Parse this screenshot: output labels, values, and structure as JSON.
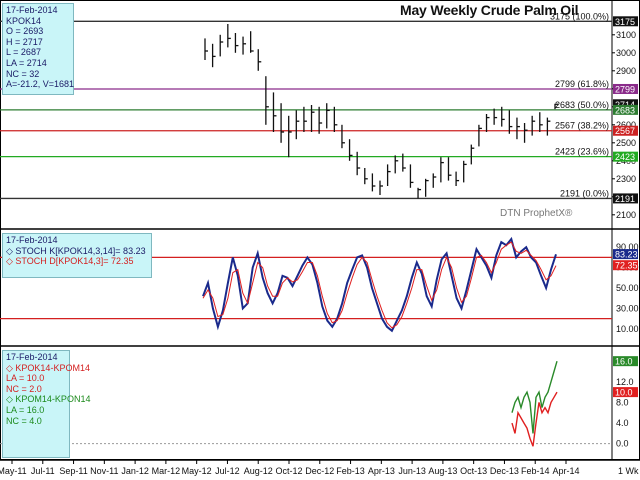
{
  "title": "May Weekly Crude Palm Oil",
  "watermark": "DTN ProphetX®",
  "price_panel": {
    "info": {
      "date": "17-Feb-2014",
      "symbol": "KPOK14",
      "open": "O = 2693",
      "high": "H = 2717",
      "low": "L = 2687",
      "last": "LA = 2714",
      "nc": "NC = 32",
      "avg": "A=-21.2, V=1681"
    },
    "fib_levels": [
      {
        "value": 3175,
        "label": "3175 (100.0%)",
        "color": "#333333"
      },
      {
        "value": 2799,
        "label": "2799 (61.8%)",
        "color": "#8a2b8a"
      },
      {
        "value": 2683,
        "label": "2683 (50.0%)",
        "color": "#2e7d32"
      },
      {
        "value": 2567,
        "label": "2567 (38.2%)",
        "color": "#cc2222"
      },
      {
        "value": 2423,
        "label": "2423 (23.6%)",
        "color": "#22aa22"
      },
      {
        "value": 2191,
        "label": "2191 (0.0%)",
        "color": "#333333"
      }
    ],
    "y_ticks": [
      "3100",
      "3000",
      "2900",
      "2800",
      "2700",
      "2600",
      "2500",
      "2400",
      "2300",
      "2200",
      "2100"
    ],
    "right_markers": [
      {
        "value": 3175,
        "label": "3175",
        "bg": "#111111"
      },
      {
        "value": 2799,
        "label": "2799",
        "bg": "#8a2b8a"
      },
      {
        "value": 2714,
        "label": "2714",
        "bg": "#111111"
      },
      {
        "value": 2683,
        "label": "2683",
        "bg": "#2e7d32"
      },
      {
        "value": 2567,
        "label": "2567",
        "bg": "#cc2222"
      },
      {
        "value": 2423,
        "label": "2423",
        "bg": "#22aa22"
      },
      {
        "value": 2191,
        "label": "2191",
        "bg": "#111111"
      }
    ]
  },
  "stoch_panel": {
    "info": {
      "date": "17-Feb-2014",
      "k_label": "STOCH K[KPOK14,3,14]= 83.23",
      "d_label": "STOCH D[KPOK14,3]= 72.35"
    },
    "y_ticks": [
      "90.00",
      "70.00",
      "50.00",
      "30.00",
      "10.00"
    ],
    "k_value": "83.23",
    "d_value": "72.35",
    "upper_line": 80,
    "lower_line": 20
  },
  "spread_panel": {
    "info": {
      "date": "17-Feb-2014",
      "s1_name": "KPOK14-KPOM14",
      "s1_la": "LA = 10.0",
      "s1_nc": "NC = 2.0",
      "s2_name": "KPOM14-KPON14",
      "s2_la": "LA = 16.0",
      "s2_nc": "NC = 4.0"
    },
    "y_ticks": [
      "12.0",
      "8.0",
      "4.0",
      "0.0"
    ],
    "s1_value": "10.0",
    "s2_value": "16.0",
    "unit_label": "1 Wk"
  },
  "x_axis": {
    "labels": [
      "May-11",
      "Jul-11",
      "Sep-11",
      "Nov-11",
      "Jan-12",
      "Mar-12",
      "May-12",
      "Jul-12",
      "Aug-12",
      "Oct-12",
      "Dec-12",
      "Feb-13",
      "Apr-13",
      "Jun-13",
      "Aug-13",
      "Oct-13",
      "Dec-13",
      "Feb-14",
      "Apr-14"
    ]
  },
  "colors": {
    "price_bars": "#111111",
    "stoch_k": "#1a2a8c",
    "stoch_d": "#e02020",
    "spread1": "#e02020",
    "spread2": "#2a8a2a",
    "info_bg": "#c9f5f8"
  },
  "chart_data": [
    {
      "type": "ohlc",
      "title": "May Weekly Crude Palm Oil",
      "series": [
        {
          "name": "KPOK14",
          "x": [
            "2012-05-14",
            "2012-05-28",
            "2012-06-11",
            "2012-06-25",
            "2012-07-09",
            "2012-07-23",
            "2012-08-06",
            "2012-08-20",
            "2012-09-03",
            "2012-09-17",
            "2012-10-01",
            "2012-10-15",
            "2012-10-29",
            "2012-11-12",
            "2012-11-26",
            "2012-12-10",
            "2012-12-24",
            "2013-01-07",
            "2013-01-21",
            "2013-02-04",
            "2013-02-18",
            "2013-03-04",
            "2013-03-18",
            "2013-04-01",
            "2013-04-15",
            "2013-04-29",
            "2013-05-13",
            "2013-05-27",
            "2013-06-10",
            "2013-06-24",
            "2013-07-08",
            "2013-07-22",
            "2013-08-05",
            "2013-08-19",
            "2013-09-02",
            "2013-09-16",
            "2013-09-30",
            "2013-10-14",
            "2013-10-28",
            "2013-11-11",
            "2013-11-25",
            "2013-12-09",
            "2013-12-23",
            "2014-01-06",
            "2014-01-20",
            "2014-02-03",
            "2014-02-17"
          ],
          "high": [
            3080,
            3050,
            3100,
            3160,
            3110,
            3090,
            3120,
            3020,
            2870,
            2780,
            2720,
            2650,
            2680,
            2700,
            2710,
            2700,
            2720,
            2700,
            2600,
            2520,
            2450,
            2360,
            2330,
            2290,
            2380,
            2430,
            2440,
            2380,
            2250,
            2300,
            2330,
            2420,
            2420,
            2340,
            2400,
            2490,
            2600,
            2660,
            2690,
            2700,
            2680,
            2640,
            2610,
            2650,
            2670,
            2640,
            2717
          ],
          "low": [
            2960,
            2920,
            2980,
            3030,
            3000,
            2990,
            3000,
            2900,
            2600,
            2560,
            2500,
            2420,
            2520,
            2560,
            2560,
            2550,
            2580,
            2560,
            2470,
            2400,
            2320,
            2270,
            2230,
            2210,
            2260,
            2330,
            2340,
            2250,
            2191,
            2200,
            2250,
            2280,
            2290,
            2260,
            2280,
            2380,
            2480,
            2560,
            2600,
            2590,
            2550,
            2520,
            2500,
            2540,
            2560,
            2540,
            2687
          ],
          "close": [
            3010,
            2980,
            3060,
            3080,
            3040,
            3050,
            3010,
            2950,
            2700,
            2650,
            2560,
            2560,
            2620,
            2620,
            2670,
            2610,
            2680,
            2600,
            2500,
            2430,
            2360,
            2300,
            2260,
            2260,
            2340,
            2400,
            2360,
            2280,
            2240,
            2290,
            2310,
            2390,
            2320,
            2290,
            2380,
            2470,
            2580,
            2640,
            2640,
            2630,
            2590,
            2590,
            2570,
            2620,
            2600,
            2620,
            2714
          ]
        }
      ],
      "ylim": [
        2060,
        3260
      ],
      "fib_levels": [
        3175,
        2799,
        2683,
        2567,
        2423,
        2191
      ]
    },
    {
      "type": "line",
      "title": "STOCH",
      "ylim": [
        0,
        100
      ],
      "series": [
        {
          "name": "STOCH K[KPOK14,3,14]",
          "values": [
            42,
            55,
            30,
            12,
            28,
            55,
            80,
            62,
            30,
            35,
            70,
            84,
            60,
            45,
            35,
            45,
            62,
            60,
            52,
            62,
            72,
            80,
            73,
            55,
            32,
            18,
            12,
            20,
            35,
            55,
            68,
            80,
            82,
            70,
            50,
            35,
            20,
            12,
            8,
            18,
            28,
            42,
            60,
            75,
            64,
            42,
            32,
            58,
            78,
            84,
            62,
            40,
            30,
            48,
            68,
            88,
            80,
            72,
            60,
            82,
            95,
            92,
            98,
            80,
            86,
            90,
            80,
            75,
            62,
            50,
            68,
            83
          ]
        },
        {
          "name": "STOCH D[KPOK14,3]",
          "values": [
            40,
            48,
            40,
            22,
            24,
            40,
            65,
            68,
            45,
            35,
            55,
            75,
            70,
            52,
            42,
            42,
            55,
            60,
            56,
            58,
            66,
            75,
            75,
            62,
            42,
            25,
            16,
            18,
            28,
            45,
            60,
            73,
            80,
            75,
            58,
            42,
            28,
            16,
            11,
            14,
            22,
            35,
            50,
            68,
            68,
            52,
            38,
            48,
            68,
            80,
            70,
            50,
            36,
            42,
            60,
            80,
            82,
            75,
            65,
            75,
            88,
            92,
            95,
            86,
            84,
            87,
            82,
            77,
            68,
            58,
            62,
            72
          ]
        }
      ],
      "hlines": [
        80,
        20
      ]
    },
    {
      "type": "line",
      "title": "Spreads",
      "ylim": [
        -2,
        17
      ],
      "series": [
        {
          "name": "KPOK14-KPOM14",
          "values": [
            4,
            2,
            6,
            5,
            4,
            3,
            1,
            -0.5,
            4,
            8,
            6,
            7,
            6,
            8,
            9,
            10
          ]
        },
        {
          "name": "KPOM14-KPON14",
          "values": [
            6,
            8,
            9,
            7,
            9,
            10,
            8,
            2,
            9,
            10,
            7,
            9,
            10,
            12,
            14,
            16
          ]
        }
      ]
    }
  ]
}
